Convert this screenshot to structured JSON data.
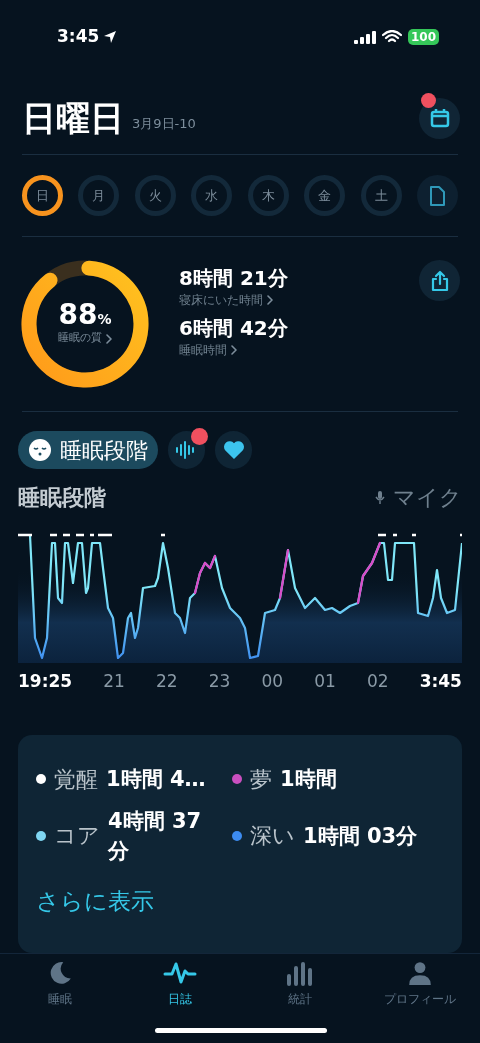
{
  "status_bar": {
    "time": "3:45",
    "battery": "100"
  },
  "header": {
    "title": "日曜日",
    "date": "3月9日-10",
    "calendar_badge": true
  },
  "days": [
    {
      "label": "日",
      "selected": true
    },
    {
      "label": "月",
      "selected": false
    },
    {
      "label": "火",
      "selected": false
    },
    {
      "label": "水",
      "selected": false
    },
    {
      "label": "木",
      "selected": false
    },
    {
      "label": "金",
      "selected": false
    },
    {
      "label": "土",
      "selected": false
    }
  ],
  "summary": {
    "quality": {
      "value": "88",
      "unit": "%",
      "label": "睡眠の質"
    },
    "stats": [
      {
        "value": "8時間 21分",
        "label": "寝床にいた時間"
      },
      {
        "value": "6時間 42分",
        "label": "睡眠時間"
      }
    ]
  },
  "view_tabs": [
    {
      "kind": "stages",
      "label": "睡眠段階",
      "selected": true,
      "badge": false
    },
    {
      "kind": "sound",
      "selected": false,
      "badge": true
    },
    {
      "kind": "heart",
      "selected": false,
      "badge": false
    }
  ],
  "chart": {
    "title": "睡眠段階",
    "source": "マイク",
    "axis_labels": [
      {
        "text": "19:25",
        "emphasized": true
      },
      {
        "text": "21",
        "emphasized": false
      },
      {
        "text": "22",
        "emphasized": false
      },
      {
        "text": "23",
        "emphasized": false
      },
      {
        "text": "00",
        "emphasized": false
      },
      {
        "text": "01",
        "emphasized": false
      },
      {
        "text": "02",
        "emphasized": false
      },
      {
        "text": "3:45",
        "emphasized": true
      }
    ]
  },
  "legend": {
    "items": [
      {
        "name": "覚醒",
        "value": "1時間 4…",
        "color": "#ffffff"
      },
      {
        "name": "夢",
        "value": "1時間",
        "color": "#c94fbf"
      },
      {
        "name": "コア",
        "value": "4時間 37分",
        "color": "#7fd6f2"
      },
      {
        "name": "深い",
        "value": "1時間 03分",
        "color": "#3d8cf0"
      }
    ],
    "more": "さらに表示"
  },
  "nav": [
    {
      "kind": "moon",
      "label": "睡眠",
      "selected": false
    },
    {
      "kind": "wave",
      "label": "日誌",
      "selected": true
    },
    {
      "kind": "bars",
      "label": "統計",
      "selected": false
    },
    {
      "kind": "person",
      "label": "プロフィール",
      "selected": false
    }
  ]
}
